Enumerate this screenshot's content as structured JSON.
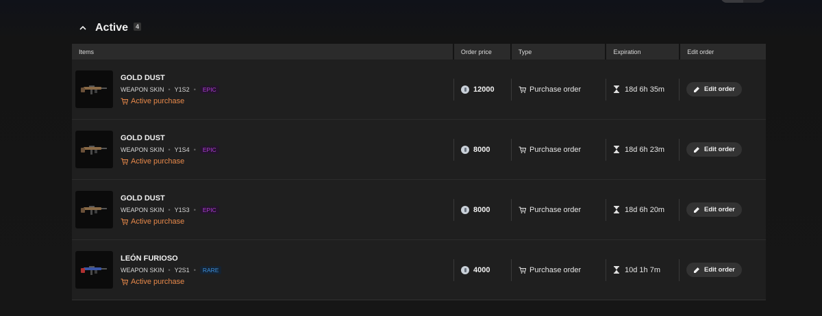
{
  "section": {
    "title": "Active",
    "count": "4"
  },
  "columns": {
    "items": "Items",
    "price": "Order price",
    "type": "Type",
    "expiration": "Expiration",
    "edit": "Edit order"
  },
  "rows": [
    {
      "name": "GOLD DUST",
      "category": "WEAPON SKIN",
      "season": "Y1S2",
      "rarity": "EPIC",
      "status": "Active purchase",
      "price": "12000",
      "type": "Purchase order",
      "expiration": "18d 6h 35m",
      "edit_label": "Edit order"
    },
    {
      "name": "GOLD DUST",
      "category": "WEAPON SKIN",
      "season": "Y1S4",
      "rarity": "EPIC",
      "status": "Active purchase",
      "price": "8000",
      "type": "Purchase order",
      "expiration": "18d 6h 23m",
      "edit_label": "Edit order"
    },
    {
      "name": "GOLD DUST",
      "category": "WEAPON SKIN",
      "season": "Y1S3",
      "rarity": "EPIC",
      "status": "Active purchase",
      "price": "8000",
      "type": "Purchase order",
      "expiration": "18d 6h 20m",
      "edit_label": "Edit order"
    },
    {
      "name": "LEÓN FURIOSO",
      "category": "WEAPON SKIN",
      "season": "Y2S1",
      "rarity": "RARE",
      "status": "Active purchase",
      "price": "4000",
      "type": "Purchase order",
      "expiration": "10d 1h 7m",
      "edit_label": "Edit order"
    }
  ],
  "colors": {
    "status": "#e8894a",
    "epic": "#b03ad8",
    "rare": "#3d8fdc"
  },
  "icons": {
    "collapse": "chevron-up-icon",
    "coin": "credit-coin-icon",
    "cart": "cart-icon",
    "timer": "hourglass-icon",
    "edit": "pencil-icon"
  }
}
